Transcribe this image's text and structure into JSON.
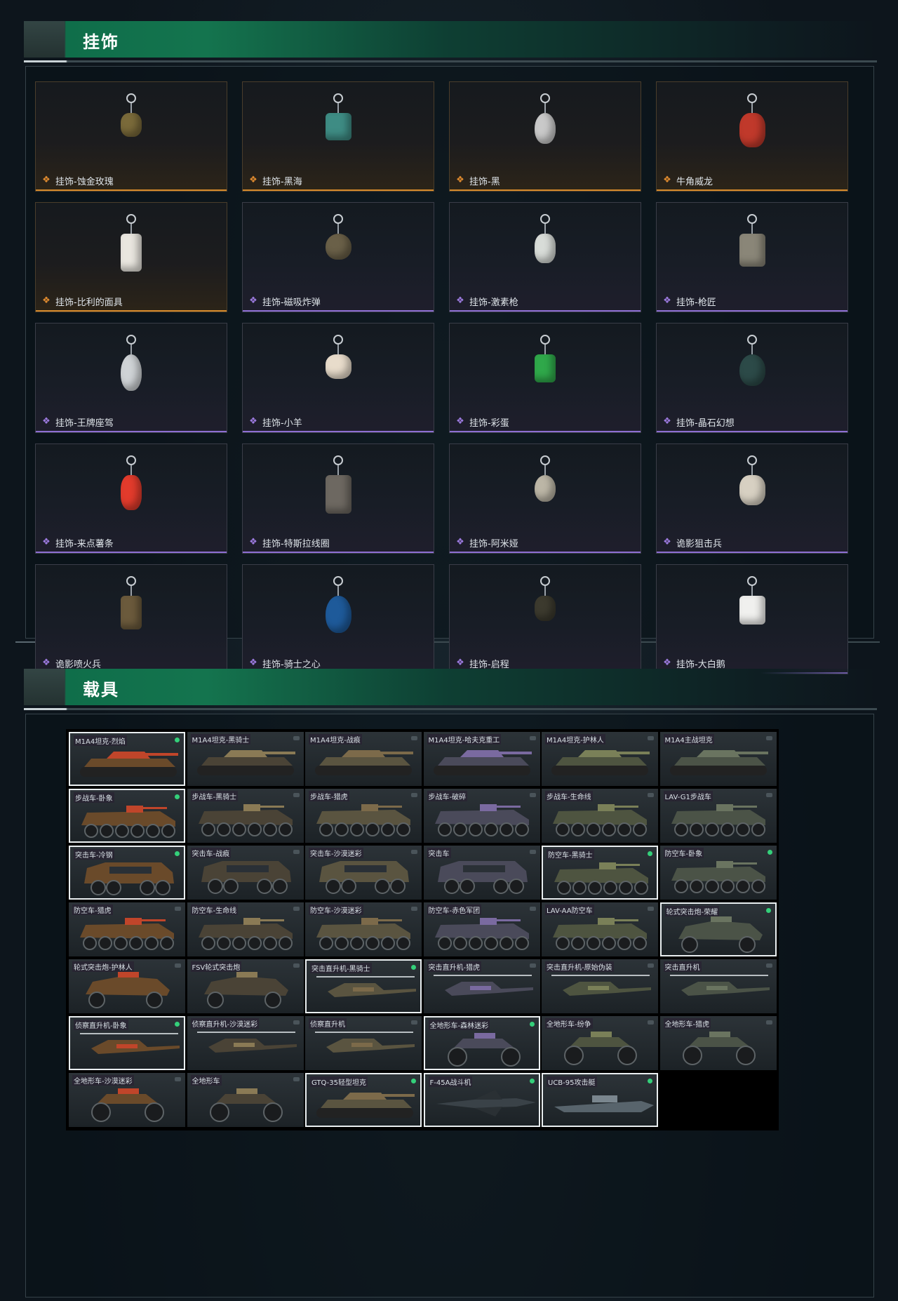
{
  "charms_section": {
    "title": "挂饰",
    "items": [
      {
        "name": "挂饰-蚀金玫瑰",
        "rarity": "legendary"
      },
      {
        "name": "挂饰-黑海",
        "rarity": "legendary"
      },
      {
        "name": "挂饰-黑",
        "rarity": "legendary"
      },
      {
        "name": "牛角威龙",
        "rarity": "legendary"
      },
      {
        "name": "挂饰-比利的面具",
        "rarity": "legendary"
      },
      {
        "name": "挂饰-磁吸炸弹",
        "rarity": "epic"
      },
      {
        "name": "挂饰-激素枪",
        "rarity": "epic"
      },
      {
        "name": "挂饰-枪匠",
        "rarity": "epic"
      },
      {
        "name": "挂饰-王牌座驾",
        "rarity": "epic"
      },
      {
        "name": "挂饰-小羊",
        "rarity": "epic"
      },
      {
        "name": "挂饰-彩蛋",
        "rarity": "epic"
      },
      {
        "name": "挂饰-晶石幻想",
        "rarity": "epic"
      },
      {
        "name": "挂饰-来点薯条",
        "rarity": "epic"
      },
      {
        "name": "挂饰-特斯拉线圈",
        "rarity": "epic"
      },
      {
        "name": "挂饰-阿米娅",
        "rarity": "epic"
      },
      {
        "name": "诡影狙击兵",
        "rarity": "epic"
      },
      {
        "name": "诡影喷火兵",
        "rarity": "epic"
      },
      {
        "name": "挂饰-骑士之心",
        "rarity": "epic"
      },
      {
        "name": "挂饰-启程",
        "rarity": "epic"
      },
      {
        "name": "挂饰-大白鹅",
        "rarity": "epic"
      }
    ],
    "colors": {
      "legendary": "#e08b2f",
      "epic": "#9d7be0"
    }
  },
  "vehicles_section": {
    "title": "载具",
    "items": [
      {
        "name": "M1A4坦克-烈焰",
        "kind": "tank",
        "selected": true,
        "owned": true
      },
      {
        "name": "M1A4坦克-黑骑士",
        "kind": "tank",
        "selected": false,
        "owned": false
      },
      {
        "name": "M1A4坦克-战痕",
        "kind": "tank",
        "selected": false,
        "owned": false
      },
      {
        "name": "M1A4坦克-哈夫克重工",
        "kind": "tank",
        "selected": false,
        "owned": false
      },
      {
        "name": "M1A4坦克-护林人",
        "kind": "tank",
        "selected": false,
        "owned": false
      },
      {
        "name": "M1A4主战坦克",
        "kind": "tank",
        "selected": false,
        "owned": false
      },
      {
        "name": "步战车-卧象",
        "kind": "ifv",
        "selected": true,
        "owned": true
      },
      {
        "name": "步战车-黑骑士",
        "kind": "ifv",
        "selected": false,
        "owned": false
      },
      {
        "name": "步战车-猎虎",
        "kind": "ifv",
        "selected": false,
        "owned": false
      },
      {
        "name": "步战车-破碎",
        "kind": "ifv",
        "selected": false,
        "owned": false
      },
      {
        "name": "步战车-生命线",
        "kind": "ifv",
        "selected": false,
        "owned": false
      },
      {
        "name": "LAV-G1步战车",
        "kind": "ifv",
        "selected": false,
        "owned": false
      },
      {
        "name": "突击车-冷钢",
        "kind": "mrap",
        "selected": true,
        "owned": true
      },
      {
        "name": "突击车-战痕",
        "kind": "mrap",
        "selected": false,
        "owned": false
      },
      {
        "name": "突击车-沙漠迷彩",
        "kind": "mrap",
        "selected": false,
        "owned": false
      },
      {
        "name": "突击车",
        "kind": "mrap",
        "selected": false,
        "owned": false
      },
      {
        "name": "防空车-黑骑士",
        "kind": "ifv",
        "selected": true,
        "owned": true
      },
      {
        "name": "防空车-卧象",
        "kind": "ifv",
        "selected": false,
        "owned": true
      },
      {
        "name": "防空车-猎虎",
        "kind": "ifv",
        "selected": false,
        "owned": false
      },
      {
        "name": "防空车-生命线",
        "kind": "ifv",
        "selected": false,
        "owned": false
      },
      {
        "name": "防空车-沙漠迷彩",
        "kind": "ifv",
        "selected": false,
        "owned": false
      },
      {
        "name": "防空车-赤色军团",
        "kind": "ifv",
        "selected": false,
        "owned": false
      },
      {
        "name": "LAV-AA防空车",
        "kind": "ifv",
        "selected": false,
        "owned": false
      },
      {
        "name": "轮式突击炮-荣耀",
        "kind": "buggy",
        "selected": true,
        "owned": true
      },
      {
        "name": "轮式突击炮-护林人",
        "kind": "buggy",
        "selected": false,
        "owned": false
      },
      {
        "name": "FSV轮式突击炮",
        "kind": "buggy",
        "selected": false,
        "owned": false
      },
      {
        "name": "突击直升机-黑骑士",
        "kind": "heli",
        "selected": true,
        "owned": true
      },
      {
        "name": "突击直升机-猎虎",
        "kind": "heli",
        "selected": false,
        "owned": false
      },
      {
        "name": "突击直升机-原始伪装",
        "kind": "heli",
        "selected": false,
        "owned": false
      },
      {
        "name": "突击直升机",
        "kind": "heli",
        "selected": false,
        "owned": false
      },
      {
        "name": "侦察直升机-卧象",
        "kind": "scout",
        "selected": true,
        "owned": true
      },
      {
        "name": "侦察直升机-沙漠迷彩",
        "kind": "scout",
        "selected": false,
        "owned": false
      },
      {
        "name": "侦察直升机",
        "kind": "scout",
        "selected": false,
        "owned": false
      },
      {
        "name": "全地形车-森林迷彩",
        "kind": "atv",
        "selected": true,
        "owned": true
      },
      {
        "name": "全地形车-纷争",
        "kind": "atv",
        "selected": false,
        "owned": false
      },
      {
        "name": "全地形车-猎虎",
        "kind": "atv",
        "selected": false,
        "owned": false
      },
      {
        "name": "全地形车-沙漠迷彩",
        "kind": "atv",
        "selected": false,
        "owned": false
      },
      {
        "name": "全地形车",
        "kind": "atv",
        "selected": false,
        "owned": false
      },
      {
        "name": "GTQ-35轻型坦克",
        "kind": "tank",
        "selected": true,
        "owned": true
      },
      {
        "name": "F-45A战斗机",
        "kind": "jet",
        "selected": true,
        "owned": true
      },
      {
        "name": "UCB-95攻击艇",
        "kind": "boat",
        "selected": true,
        "owned": true
      }
    ],
    "colors": {
      "owned_dot": "#34d07a",
      "selected_border": "#e9eef0"
    }
  }
}
